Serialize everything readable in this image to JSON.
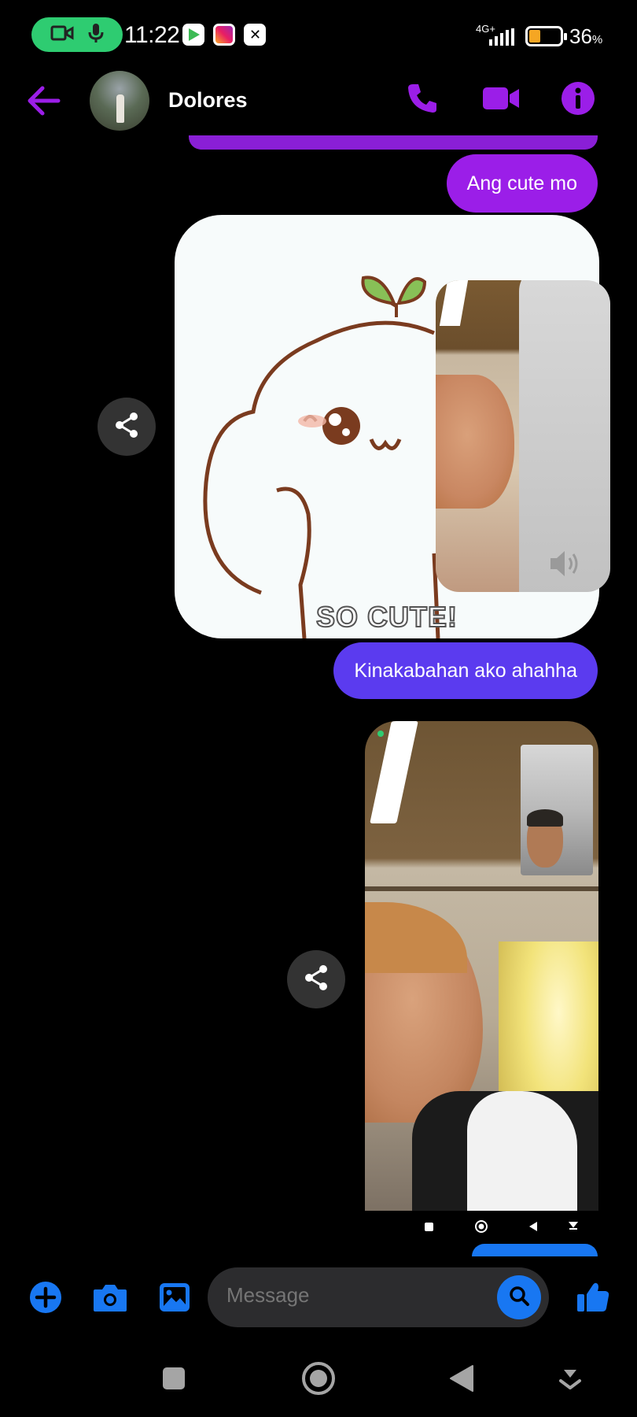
{
  "status_bar": {
    "time": "11:22",
    "network_type": "4G+",
    "battery_percent": "36",
    "battery_unit": "%",
    "battery_level": 0.36,
    "call_indicator_color": "#2ecc71",
    "notification_icons": [
      "google-play-icon",
      "instagram-icon",
      "capcut-icon"
    ]
  },
  "header": {
    "contact_name": "Dolores",
    "accent_color": "#9b1ee8",
    "actions": [
      "voice-call-icon",
      "video-call-icon",
      "info-icon"
    ]
  },
  "messages": [
    {
      "type": "text",
      "sender": "me",
      "text": "Ang cute mo",
      "color": "#9b1ee8"
    },
    {
      "type": "sticker",
      "sender": "me",
      "caption": "SO CUTE!"
    },
    {
      "type": "text",
      "sender": "me",
      "text": "Kinakabahan ako ahahha",
      "color": "#5b3bef"
    },
    {
      "type": "video-screenshot",
      "sender": "me"
    }
  ],
  "composer": {
    "placeholder": "Message",
    "icons": [
      "add-icon",
      "camera-icon",
      "gallery-icon",
      "search-icon",
      "like-icon"
    ],
    "accent_color": "#1877f2"
  },
  "system_nav": [
    "recents-icon",
    "home-icon",
    "back-icon",
    "hide-nav-icon"
  ]
}
